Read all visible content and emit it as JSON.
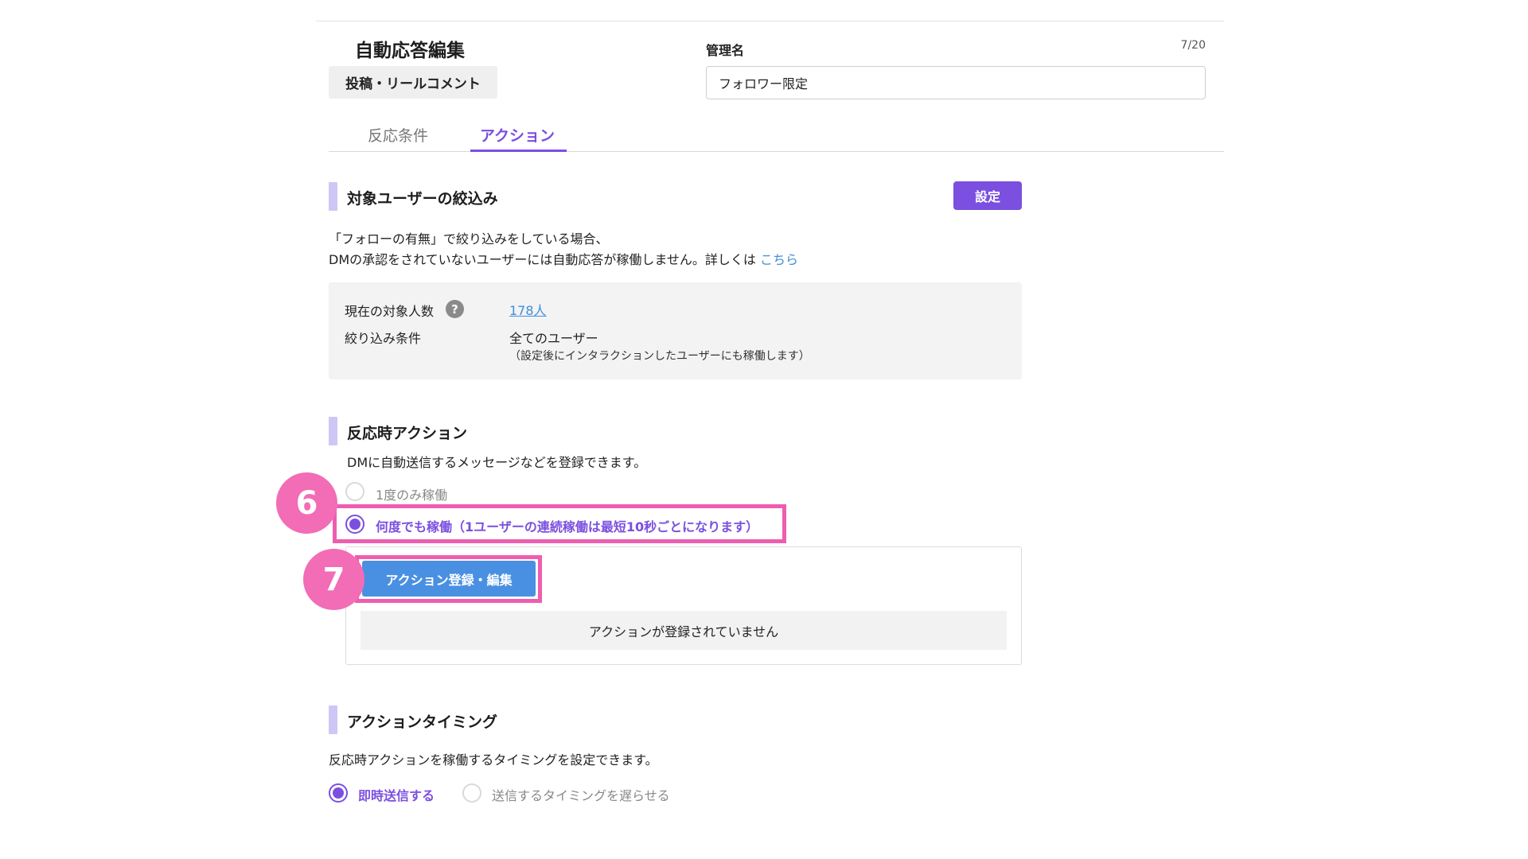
{
  "header": {
    "title": "自動応答編集",
    "type_chip": "投稿・リールコメント",
    "name_label": "管理名",
    "name_counter": "7/20",
    "name_value": "フォロワー限定"
  },
  "tabs": [
    {
      "label": "反応条件",
      "active": false
    },
    {
      "label": "アクション",
      "active": true
    }
  ],
  "target_section": {
    "title": "対象ユーザーの絞込み",
    "set_button": "設定",
    "desc_line1": "「フォローの有無」で絞り込みをしている場合、",
    "desc_line2": "DMの承認をされていないユーザーには自動応答が稼働しません。詳しくは",
    "desc_link": "こちら",
    "info": {
      "count_label": "現在の対象人数",
      "help_glyph": "?",
      "count_value": "178人",
      "condition_label": "絞り込み条件",
      "condition_value": "全てのユーザー",
      "condition_note": "（設定後にインタラクションしたユーザーにも稼働します）"
    }
  },
  "reaction_section": {
    "title": "反応時アクション",
    "desc": "DMに自動送信するメッセージなどを登録できます。",
    "option_once": "1度のみ稼働",
    "option_repeat": "何度でも稼働（1ユーザーの連続稼働は最短10秒ごとになります）",
    "selected": "repeat",
    "action_button": "アクション登録・編集",
    "empty_message": "アクションが登録されていません"
  },
  "timing_section": {
    "title": "アクションタイミング",
    "desc": "反応時アクションを稼働するタイミングを設定できます。",
    "option_immediate": "即時送信する",
    "option_delay": "送信するタイミングを遅らせる",
    "selected": "immediate"
  },
  "annotations": {
    "step6": "6",
    "step7": "7"
  },
  "colors": {
    "accent": "#7b4fe0",
    "link": "#3f8fdc",
    "action_button": "#4a90e2",
    "highlight": "#ee5db0",
    "badge": "#f26cb6",
    "section_bar": "#cfc6f6"
  },
  "icons": {
    "help": "question-circle-icon"
  }
}
